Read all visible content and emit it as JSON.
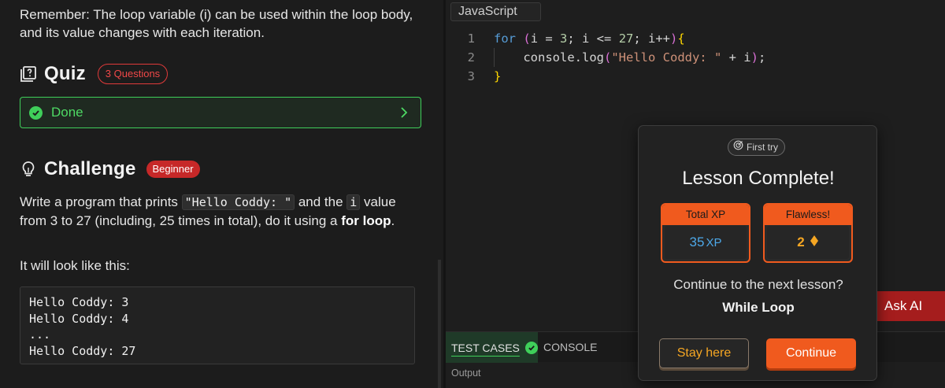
{
  "lesson": {
    "remember_text": "Remember: The loop variable (i) can be used within the loop body, and its value changes with each iteration.",
    "quiz": {
      "title": "Quiz",
      "badge": "3 Questions",
      "status_label": "Done"
    },
    "challenge": {
      "title": "Challenge",
      "badge": "Beginner",
      "text_before": "Write a program that prints ",
      "code_string": "\"Hello Coddy: \"",
      "text_middle": " and the ",
      "code_var": "i",
      "text_after": " value from 3 to 27 (including, 25 times in total), do it using a ",
      "bold_text": "for loop",
      "text_end": ".",
      "looks_like": "It will look like this:",
      "output_lines": [
        "Hello Coddy: 3",
        "Hello Coddy: 4",
        "...",
        "Hello Coddy: 27"
      ]
    }
  },
  "editor": {
    "language_tab": "JavaScript",
    "lines": [
      {
        "num": "1",
        "tokens": [
          [
            "kw",
            "for"
          ],
          [
            "plain",
            " "
          ],
          [
            "paren",
            "("
          ],
          [
            "plain",
            "i = "
          ],
          [
            "num",
            "3"
          ],
          [
            "plain",
            "; i <= "
          ],
          [
            "num",
            "27"
          ],
          [
            "plain",
            "; i++"
          ],
          [
            "paren",
            ")"
          ],
          [
            "brace",
            "{"
          ]
        ]
      },
      {
        "num": "2",
        "tokens": [
          [
            "plain",
            "    console.log"
          ],
          [
            "paren",
            "("
          ],
          [
            "str",
            "\"Hello Coddy: \""
          ],
          [
            "plain",
            " + i"
          ],
          [
            "paren",
            ")"
          ],
          [
            "plain",
            ";"
          ]
        ]
      },
      {
        "num": "3",
        "tokens": [
          [
            "brace",
            "}"
          ]
        ]
      }
    ],
    "token_colors": {
      "kw": "#569cd6",
      "num": "#b5cea8",
      "str": "#ce9178",
      "brace": "#ffd700",
      "paren": "#da70d6",
      "plain": "#d4d4d4"
    },
    "bottom_tabs": {
      "test_cases": "TEST CASES",
      "console": "CONSOLE"
    },
    "output_label": "Output",
    "ask_ai": "Ask AI"
  },
  "modal": {
    "first_try": "First try",
    "title": "Lesson Complete!",
    "total_xp_label": "Total XP",
    "total_xp_value": "35",
    "total_xp_unit": "XP",
    "flawless_label": "Flawless!",
    "flawless_value": "2",
    "next_question": "Continue to the next lesson?",
    "next_lesson": "While Loop",
    "stay_button": "Stay here",
    "continue_button": "Continue"
  },
  "colors": {
    "accent_orange": "#f05a1e",
    "success_green": "#3fcf5a",
    "badge_red": "#c62828",
    "xp_blue": "#4da8e8",
    "gem_gold": "#f5a623"
  },
  "icons": [
    "quiz-icon",
    "lightbulb-icon",
    "check-circle-icon",
    "chevron-right-icon",
    "target-icon",
    "diamond-icon"
  ]
}
